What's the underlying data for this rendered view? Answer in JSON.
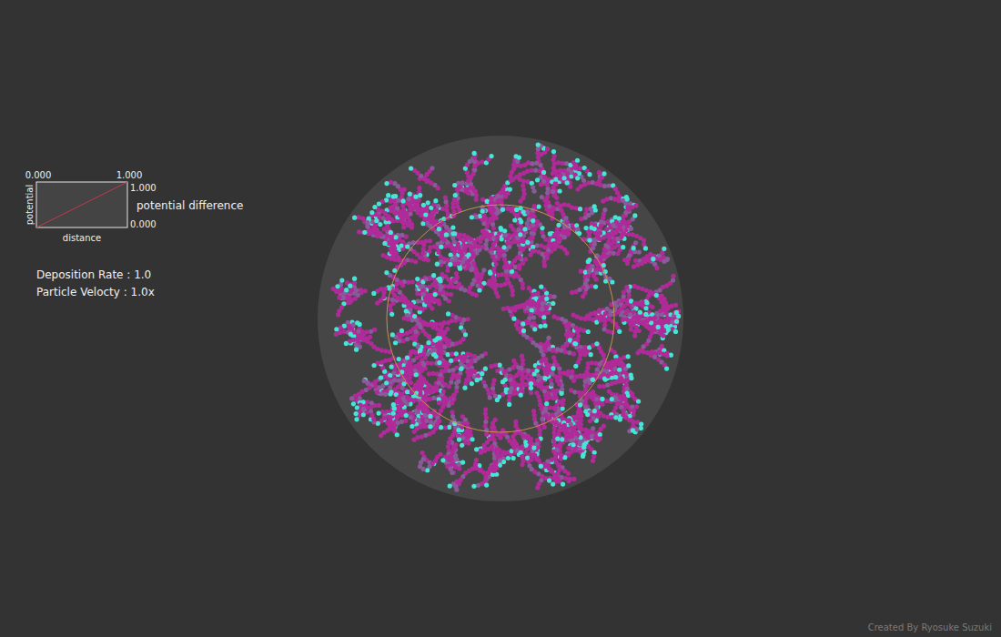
{
  "potential_chart": {
    "title": "potential difference",
    "x_label": "distance",
    "y_label": "potential",
    "x_ticks": [
      "0.000",
      "1.000"
    ],
    "y_ticks": [
      "1.000",
      "0.000"
    ],
    "series": [
      {
        "name": "potential",
        "values": [
          0,
          1
        ],
        "color": "#c0394a"
      }
    ]
  },
  "stats": [
    {
      "label": "Deposition Rate : 1.0"
    },
    {
      "label": "Particle Velocty : 1.0x"
    }
  ],
  "footer": {
    "credit": "Created By Ryosuke Suzuki"
  }
}
